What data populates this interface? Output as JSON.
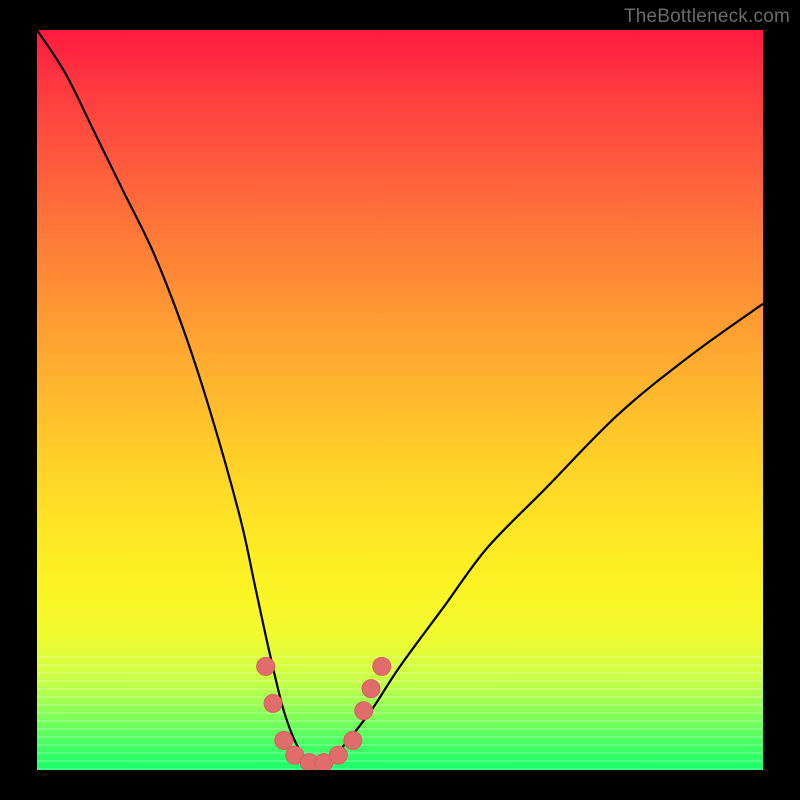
{
  "watermark": "TheBottleneck.com",
  "colors": {
    "frame": "#000000",
    "curve": "#000000",
    "marker": "#e06c6c",
    "marker_stroke": "#d45f5f"
  },
  "chart_data": {
    "type": "line",
    "title": "",
    "xlabel": "",
    "ylabel": "",
    "xlim": [
      0,
      100
    ],
    "ylim": [
      0,
      100
    ],
    "note": "Bottleneck-style V curve. Y axis is inverted visually (low y = good/green at bottom). Values approximate; no axis ticks rendered.",
    "series": [
      {
        "name": "bottleneck-curve",
        "x": [
          0,
          4,
          8,
          12,
          16,
          20,
          24,
          28,
          30,
          32,
          34,
          36,
          38,
          40,
          42,
          46,
          50,
          56,
          62,
          70,
          80,
          90,
          100
        ],
        "y": [
          100,
          94,
          86,
          78,
          70,
          60,
          48,
          34,
          25,
          16,
          8,
          3,
          1,
          1,
          3,
          8,
          14,
          22,
          30,
          38,
          48,
          56,
          63
        ]
      }
    ],
    "markers": [
      {
        "x": 31.5,
        "y": 14
      },
      {
        "x": 32.5,
        "y": 9
      },
      {
        "x": 34.0,
        "y": 4
      },
      {
        "x": 35.5,
        "y": 2
      },
      {
        "x": 37.5,
        "y": 1
      },
      {
        "x": 39.5,
        "y": 1
      },
      {
        "x": 41.5,
        "y": 2
      },
      {
        "x": 43.5,
        "y": 4
      },
      {
        "x": 45.0,
        "y": 8
      },
      {
        "x": 46.0,
        "y": 11
      },
      {
        "x": 47.5,
        "y": 14
      }
    ]
  }
}
